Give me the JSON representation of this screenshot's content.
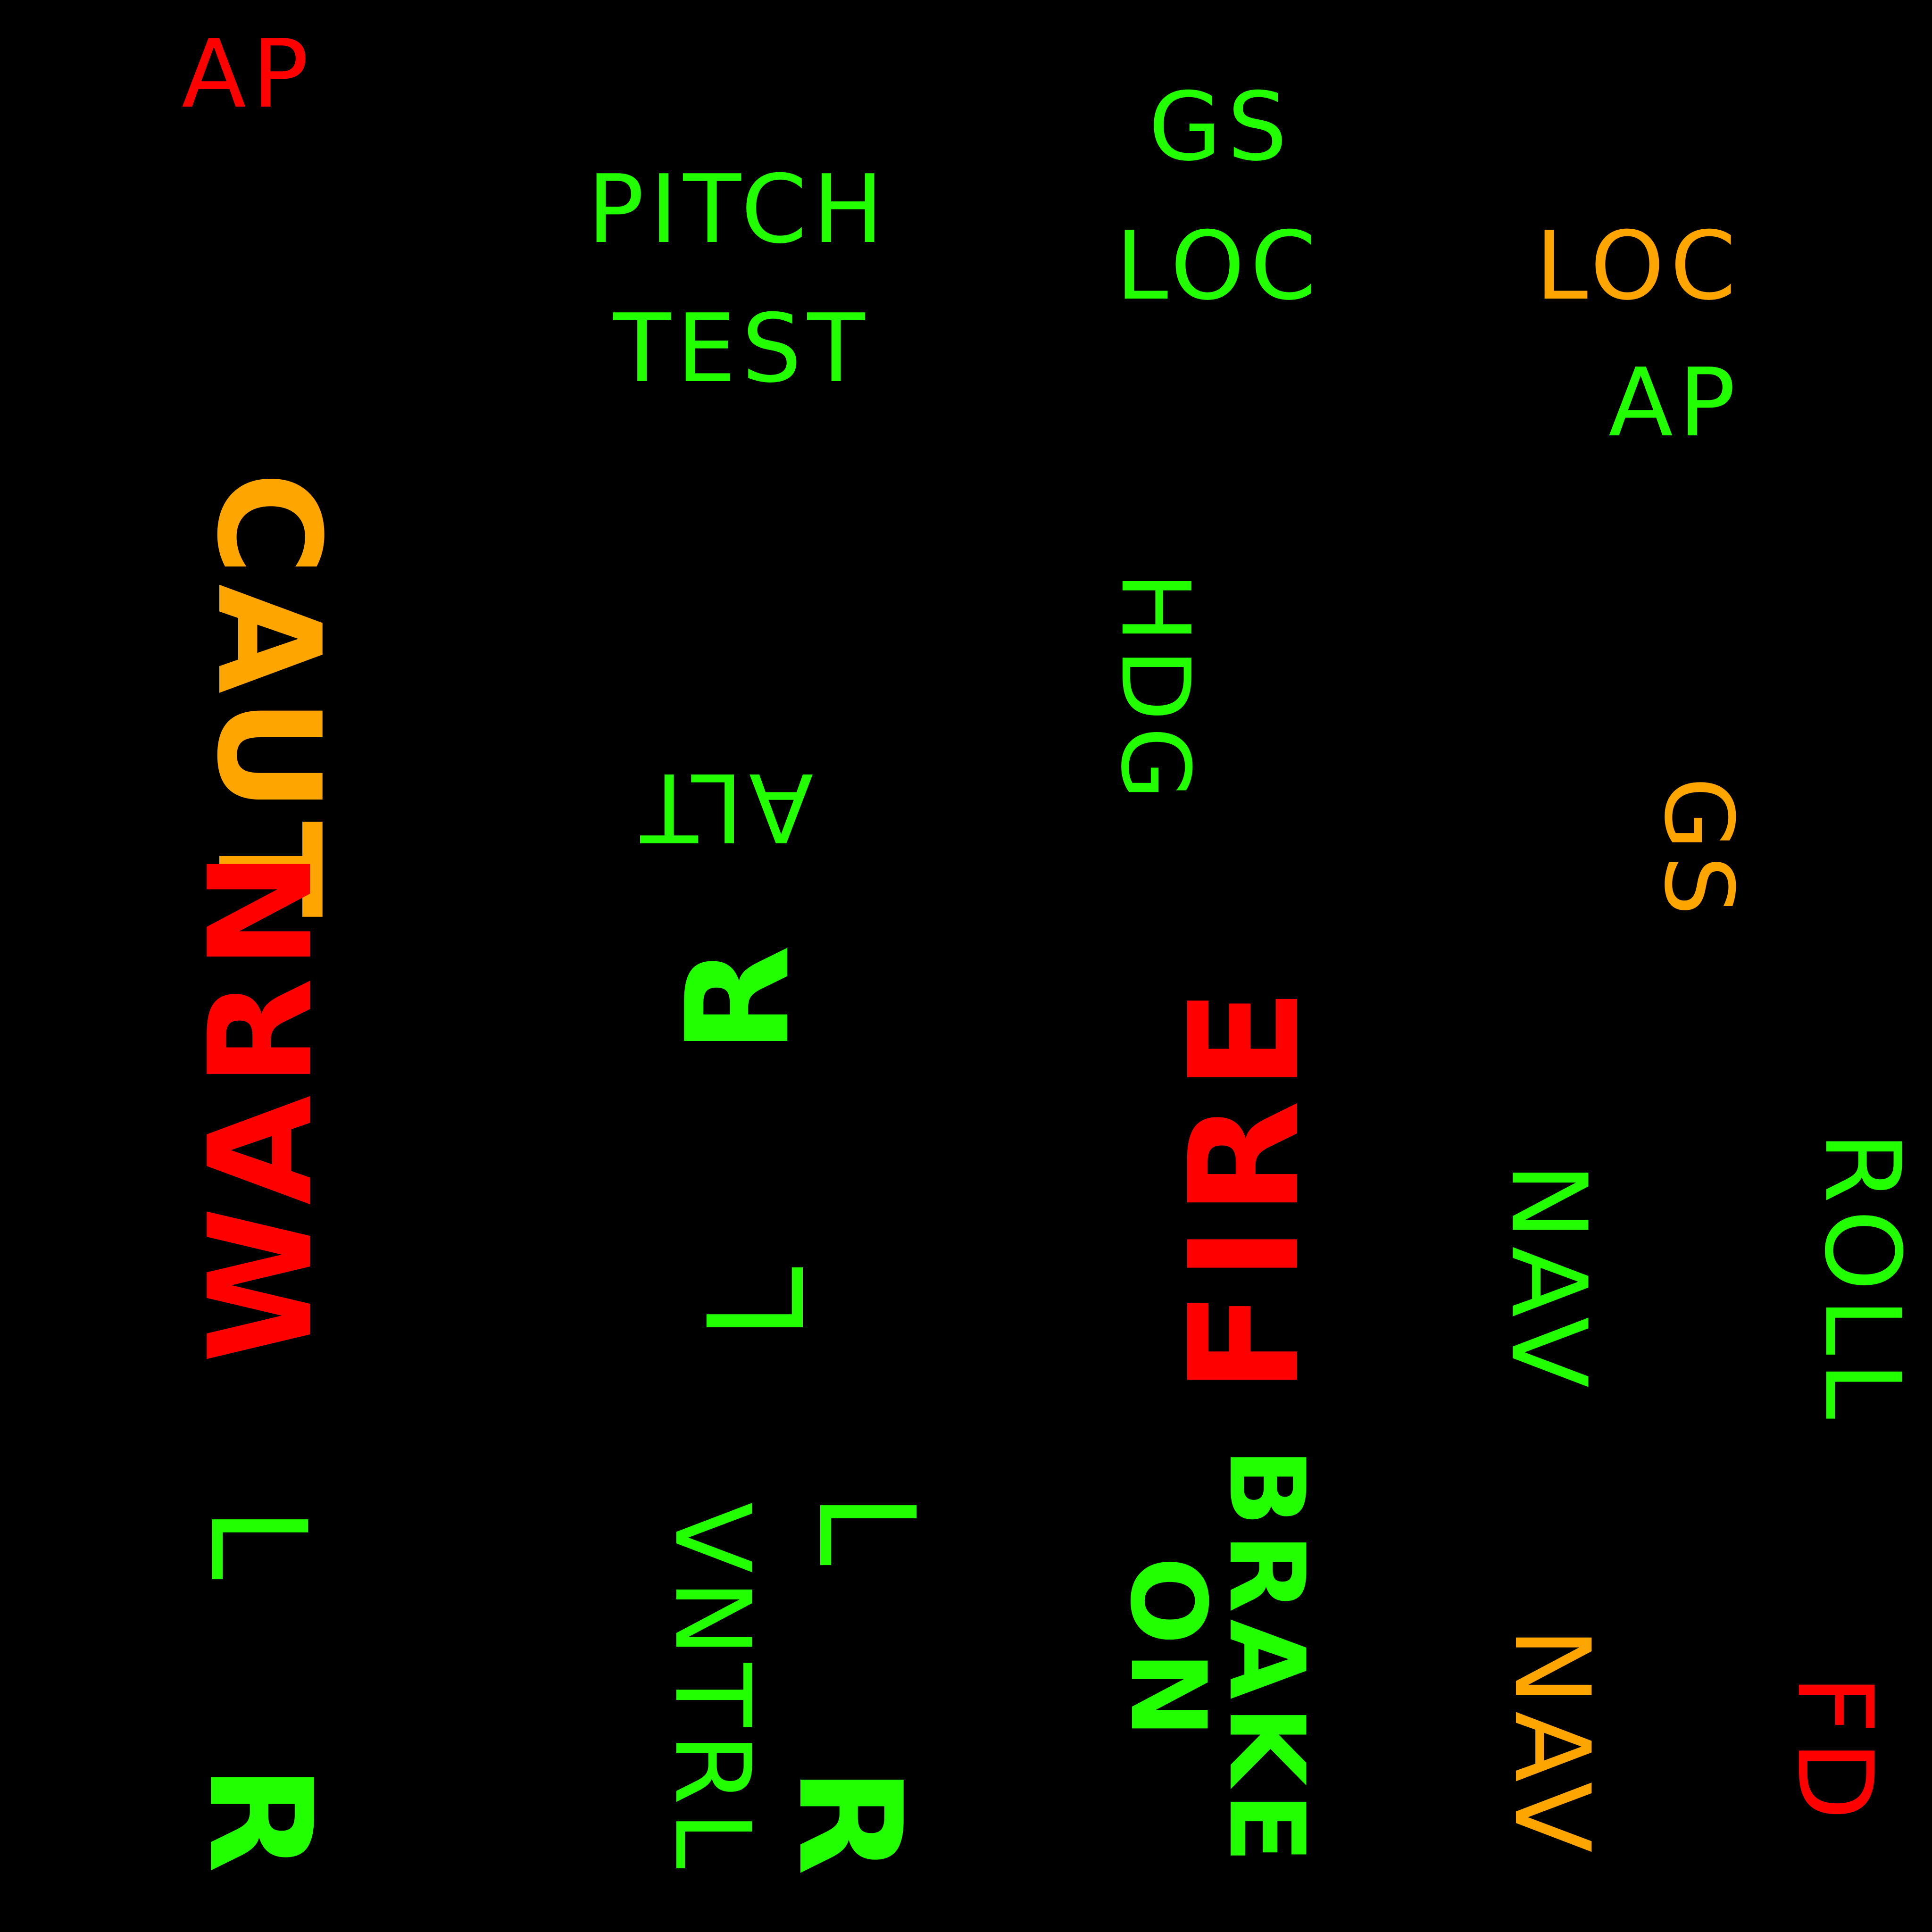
{
  "annunciators": [
    {
      "id": "ap-top-left",
      "text": "AP",
      "color": "red"
    },
    {
      "id": "pitch",
      "text": "PITCH",
      "color": "green"
    },
    {
      "id": "test",
      "text": "TEST",
      "color": "green"
    },
    {
      "id": "gs-top",
      "text": "GS",
      "color": "green"
    },
    {
      "id": "loc-center",
      "text": "LOC",
      "color": "green"
    },
    {
      "id": "loc-right",
      "text": "LOC",
      "color": "amber"
    },
    {
      "id": "ap-right",
      "text": "AP",
      "color": "green"
    },
    {
      "id": "caut",
      "text": "CAUT",
      "color": "amber"
    },
    {
      "id": "hdg",
      "text": "HDG",
      "color": "green"
    },
    {
      "id": "alt",
      "text": "ALT",
      "color": "green"
    },
    {
      "id": "gs-right",
      "text": "GS",
      "color": "amber"
    },
    {
      "id": "warn",
      "text": "WARN",
      "color": "red"
    },
    {
      "id": "r-center",
      "text": "R",
      "color": "green"
    },
    {
      "id": "fire",
      "text": "FIRE",
      "color": "red"
    },
    {
      "id": "l-center",
      "text": "L",
      "color": "green"
    },
    {
      "id": "nav-upper",
      "text": "NAV",
      "color": "green"
    },
    {
      "id": "roll",
      "text": "ROLL",
      "color": "green"
    },
    {
      "id": "l-bottom-left",
      "text": "L",
      "color": "green"
    },
    {
      "id": "vntrl",
      "text": "VNTRL",
      "color": "green"
    },
    {
      "id": "l-bottom-center",
      "text": "L",
      "color": "green"
    },
    {
      "id": "brake-on",
      "lines": [
        "BRAKE",
        "ON"
      ],
      "color": "green"
    },
    {
      "id": "nav-lower",
      "text": "NAV",
      "color": "amber"
    },
    {
      "id": "fd",
      "text": "FD",
      "color": "red"
    },
    {
      "id": "r-bottom-left",
      "text": "R",
      "color": "green"
    },
    {
      "id": "r-bottom-center",
      "text": "R",
      "color": "green"
    }
  ],
  "colors": {
    "background": "#000000",
    "green": "#22ff00",
    "amber": "#ffa500",
    "red": "#ff0000"
  }
}
